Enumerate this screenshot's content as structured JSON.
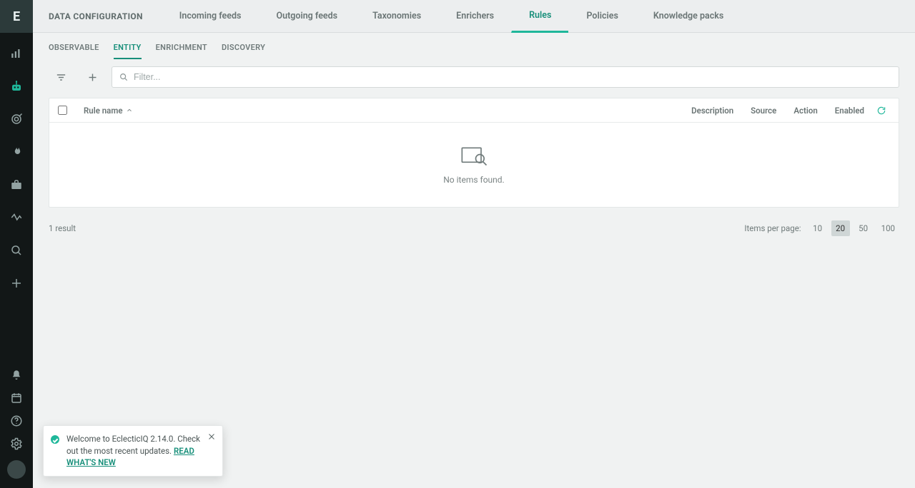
{
  "app": {
    "logo_letter": "E"
  },
  "sidebar": {
    "top_items": [
      {
        "name": "dashboard-icon"
      },
      {
        "name": "automation-icon",
        "active": true
      },
      {
        "name": "target-icon"
      },
      {
        "name": "fire-icon"
      },
      {
        "name": "briefcase-icon"
      },
      {
        "name": "activity-icon"
      },
      {
        "name": "search-icon"
      },
      {
        "name": "plus-icon"
      }
    ],
    "bottom_items": [
      {
        "name": "bell-icon"
      },
      {
        "name": "calendar-icon"
      },
      {
        "name": "help-icon"
      },
      {
        "name": "settings-icon"
      },
      {
        "name": "avatar"
      }
    ]
  },
  "header": {
    "title": "DATA CONFIGURATION",
    "tabs": [
      {
        "label": "Incoming feeds"
      },
      {
        "label": "Outgoing feeds"
      },
      {
        "label": "Taxonomies"
      },
      {
        "label": "Enrichers"
      },
      {
        "label": "Rules",
        "active": true
      },
      {
        "label": "Policies"
      },
      {
        "label": "Knowledge packs"
      }
    ]
  },
  "subtabs": [
    {
      "label": "OBSERVABLE"
    },
    {
      "label": "ENTITY",
      "active": true
    },
    {
      "label": "ENRICHMENT"
    },
    {
      "label": "DISCOVERY"
    }
  ],
  "toolbar": {
    "filter_placeholder": "Filter..."
  },
  "table": {
    "columns": {
      "rule_name": "Rule name",
      "description": "Description",
      "source": "Source",
      "action": "Action",
      "enabled": "Enabled"
    },
    "empty_text": "No items found."
  },
  "footer": {
    "result_text": "1 result",
    "items_per_page_label": "Items per page:",
    "page_sizes": [
      "10",
      "20",
      "50",
      "100"
    ],
    "active_page_size": "20"
  },
  "toast": {
    "message": "Welcome to EclecticIQ 2.14.0. Check out the most recent updates. ",
    "link_label": "READ WHAT'S NEW"
  }
}
